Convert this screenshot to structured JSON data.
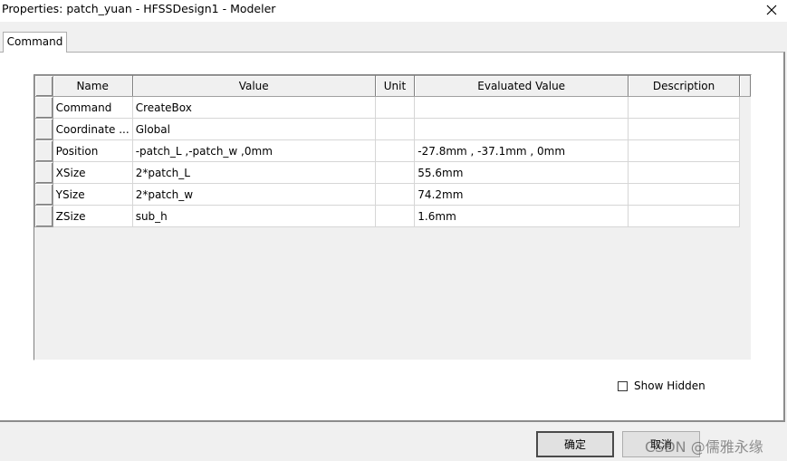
{
  "window": {
    "title": "Properties: patch_yuan - HFSSDesign1 - Modeler"
  },
  "tabs": [
    {
      "label": "Command"
    }
  ],
  "grid": {
    "columns": [
      "Name",
      "Value",
      "Unit",
      "Evaluated Value",
      "Description"
    ],
    "rows": [
      {
        "name": "Command",
        "value": "CreateBox",
        "unit": "",
        "evaluated": "",
        "description": ""
      },
      {
        "name": "Coordinate ...",
        "value": "Global",
        "unit": "",
        "evaluated": "",
        "description": ""
      },
      {
        "name": "Position",
        "value": "-patch_L ,-patch_w ,0mm",
        "unit": "",
        "evaluated": "-27.8mm , -37.1mm , 0mm",
        "description": ""
      },
      {
        "name": "XSize",
        "value": "2*patch_L",
        "unit": "",
        "evaluated": "55.6mm",
        "description": ""
      },
      {
        "name": "YSize",
        "value": "2*patch_w",
        "unit": "",
        "evaluated": "74.2mm",
        "description": ""
      },
      {
        "name": "ZSize",
        "value": "sub_h",
        "unit": "",
        "evaluated": "1.6mm",
        "description": ""
      }
    ]
  },
  "options": {
    "show_hidden_label": "Show Hidden",
    "show_hidden_checked": false
  },
  "buttons": {
    "ok": "确定",
    "cancel": "取消"
  },
  "watermark": "CSDN @儒雅永缘"
}
